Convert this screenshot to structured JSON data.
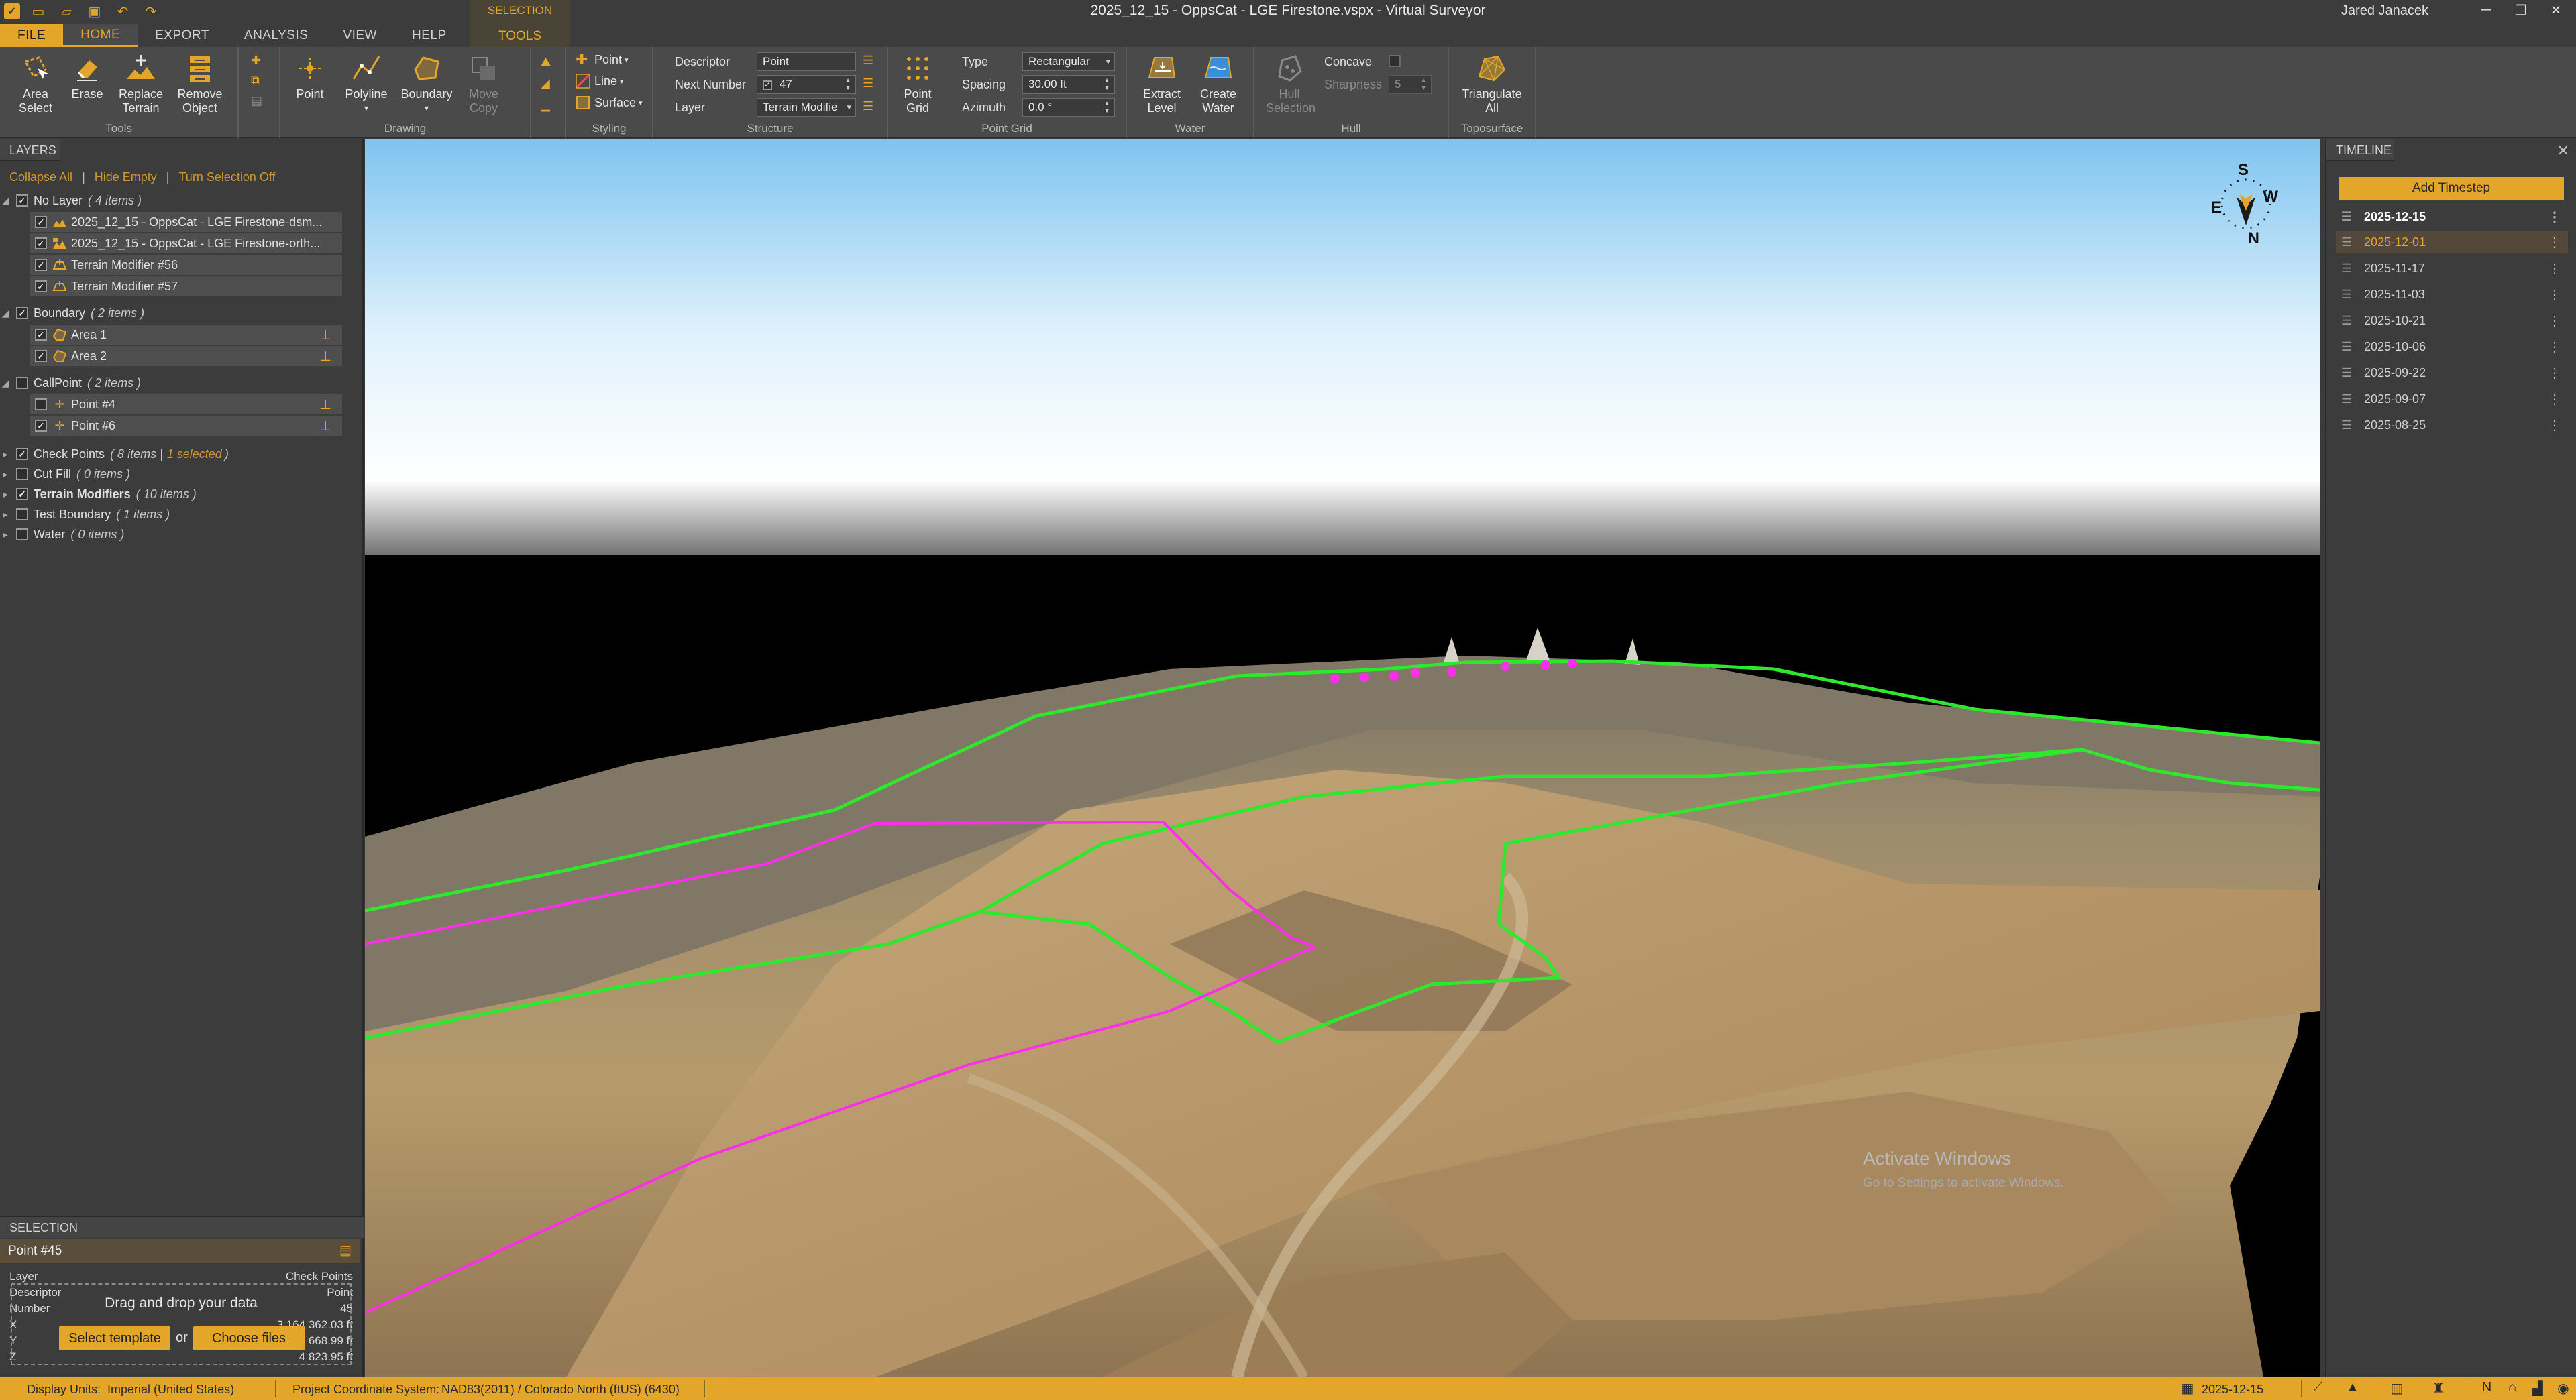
{
  "titlebar": {
    "title": "2025_12_15 - OppsCat - LGE Firestone.vspx  -  Virtual Surveyor",
    "user": "Jared Janacek",
    "minimize": "─",
    "restore": "❐",
    "close": "✕"
  },
  "tabs": {
    "file": "FILE",
    "home": "HOME",
    "export": "EXPORT",
    "analysis": "ANALYSIS",
    "view": "VIEW",
    "help": "HELP",
    "context_group": "SELECTION",
    "context_tab": "TOOLS"
  },
  "ribbon": {
    "tools": {
      "label": "Tools",
      "area_select": "Area Select",
      "erase": "Erase",
      "replace_terrain": "Replace Terrain",
      "remove_object": "Remove Object"
    },
    "drawing": {
      "label": "Drawing",
      "point": "Point",
      "polyline": "Polyline",
      "boundary": "Boundary",
      "move_copy": "Move Copy"
    },
    "styling": {
      "label": "Styling",
      "point": "Point",
      "line": "Line",
      "surface": "Surface"
    },
    "structure": {
      "label": "Structure",
      "descriptor_label": "Descriptor",
      "descriptor_value": "Point",
      "next_number_label": "Next Number",
      "next_number_value": "47",
      "layer_label": "Layer",
      "layer_value": "Terrain Modifie"
    },
    "point_grid": {
      "label": "Point Grid",
      "button": "Point Grid",
      "type_label": "Type",
      "type_value": "Rectangular",
      "spacing_label": "Spacing",
      "spacing_value": "30.00 ft",
      "azimuth_label": "Azimuth",
      "azimuth_value": "0.0 °"
    },
    "water": {
      "label": "Water",
      "extract_level": "Extract Level",
      "create_water": "Create Water"
    },
    "hull": {
      "label": "Hull",
      "hull_selection": "Hull Selection",
      "concave": "Concave",
      "sharpness_label": "Sharpness",
      "sharpness_value": "5"
    },
    "toposurface": {
      "label": "Toposurface",
      "triangulate_all": "Triangulate All"
    }
  },
  "layers_panel": {
    "title": "LAYERS",
    "collapse_all": "Collapse All",
    "hide_empty": "Hide Empty",
    "turn_selection_off": "Turn Selection Off",
    "groups": [
      {
        "name": "No Layer",
        "count": "( 4 items )"
      },
      {
        "name": "Boundary",
        "count": "( 2 items )"
      },
      {
        "name": "CallPoint",
        "count": "( 2 items )"
      },
      {
        "name": "Check Points",
        "count": "( 8 items |",
        "extra": "1 selected",
        "close": ")"
      },
      {
        "name": "Cut Fill",
        "count": "( 0 items )"
      },
      {
        "name": "Terrain Modifiers",
        "count": "( 10 items )"
      },
      {
        "name": "Test Boundary",
        "count": "( 1 items )"
      },
      {
        "name": "Water",
        "count": "( 0 items )"
      }
    ],
    "no_layer_items": [
      "2025_12_15 - OppsCat - LGE Firestone-dsm...",
      "2025_12_15 - OppsCat - LGE Firestone-orth...",
      "Terrain Modifier #56",
      "Terrain Modifier #57"
    ],
    "boundary_items": [
      "Area 1",
      "Area 2"
    ],
    "callpoint_items": [
      "Point #4",
      "Point #6"
    ]
  },
  "selection_panel": {
    "title": "SELECTION",
    "selected_name": "Point #45",
    "properties": [
      {
        "key": "Layer",
        "value": "Check Points"
      },
      {
        "key": "Descriptor",
        "value": "Point"
      },
      {
        "key": "Number",
        "value": "45"
      },
      {
        "key": "X",
        "value": "3 164 362.03 ft"
      },
      {
        "key": "Y",
        "value": "1 307 668.99 ft"
      },
      {
        "key": "Z",
        "value": "4 823.95 ft"
      }
    ]
  },
  "drop_zone": {
    "text": "Drag and drop your data",
    "select_template": "Select template",
    "or": "or",
    "choose_files": "Choose files"
  },
  "viewport": {
    "compass": {
      "n": "N",
      "s": "S",
      "e": "E",
      "w": "W"
    },
    "activate_title": "Activate Windows",
    "activate_sub": "Go to Settings to activate Windows."
  },
  "timeline": {
    "title": "TIMELINE",
    "add_timestep": "Add Timestep",
    "entries": [
      "2025-12-15",
      "2025-12-01",
      "2025-11-17",
      "2025-11-03",
      "2025-10-21",
      "2025-10-06",
      "2025-09-22",
      "2025-09-07",
      "2025-08-25"
    ]
  },
  "statusbar": {
    "display_units_label": "Display Units:",
    "display_units_value": "Imperial (United States)",
    "crs_label": "Project Coordinate System:",
    "crs_value": "NAD83(2011) / Colorado North (ftUS) (6430)",
    "date": "2025-12-15"
  },
  "colors": {
    "accent": "#e3a52a",
    "boundary_line": "#2ee82e",
    "polyline": "#ff2ee8"
  }
}
